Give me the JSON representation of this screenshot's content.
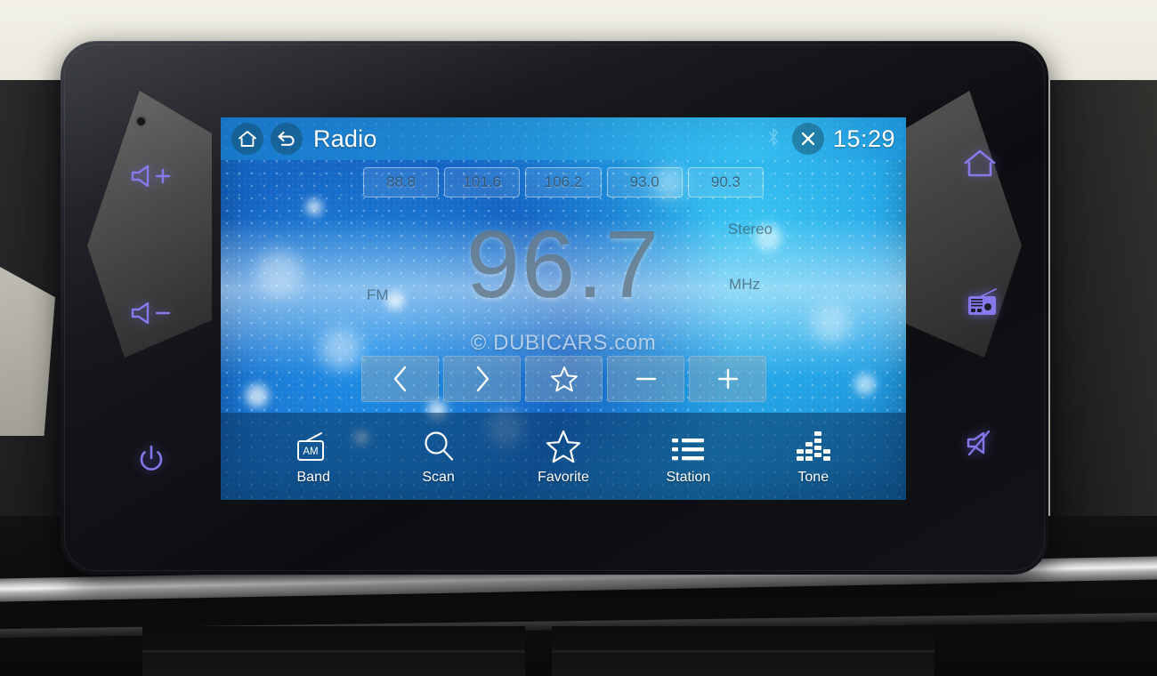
{
  "device": {
    "type": "car-infotainment-head-unit",
    "bezel_keys_left": [
      {
        "name": "volume-up",
        "icon": "speaker-plus-icon"
      },
      {
        "name": "volume-down",
        "icon": "speaker-minus-icon"
      },
      {
        "name": "power",
        "icon": "power-icon"
      }
    ],
    "bezel_keys_right": [
      {
        "name": "home",
        "icon": "home-icon"
      },
      {
        "name": "radio",
        "icon": "radio-icon"
      },
      {
        "name": "mute",
        "icon": "speaker-mute-icon"
      }
    ]
  },
  "header": {
    "home_icon": "home-icon",
    "back_icon": "back-arrow-icon",
    "title": "Radio",
    "bluetooth_icon": "bluetooth-icon",
    "close_icon": "close-icon",
    "time": "15:29"
  },
  "presets": [
    {
      "label": "88.8"
    },
    {
      "label": "101.6"
    },
    {
      "label": "106.2"
    },
    {
      "label": "93.0"
    },
    {
      "label": "90.3"
    }
  ],
  "tuner": {
    "frequency": "96.7",
    "band": "FM",
    "stereo": "Stereo",
    "unit": "MHz",
    "watermark": "© DUBICARS.com"
  },
  "controls": [
    {
      "name": "previous",
      "icon": "chevron-left-icon"
    },
    {
      "name": "next",
      "icon": "chevron-right-icon"
    },
    {
      "name": "favorite",
      "icon": "star-icon"
    },
    {
      "name": "decrease",
      "icon": "minus-icon"
    },
    {
      "name": "increase",
      "icon": "plus-icon"
    }
  ],
  "bottom_nav": [
    {
      "label": "Band",
      "icon": "am-radio-icon"
    },
    {
      "label": "Scan",
      "icon": "search-icon"
    },
    {
      "label": "Favorite",
      "icon": "star-icon"
    },
    {
      "label": "Station",
      "icon": "list-icon"
    },
    {
      "label": "Tone",
      "icon": "equalizer-icon"
    }
  ],
  "colors": {
    "accent_key_backlight": "#8b7df5",
    "screen_blue": "#1b87d6",
    "header_blue": "#1a7ece",
    "nav_overlay": "#0a3e68"
  }
}
